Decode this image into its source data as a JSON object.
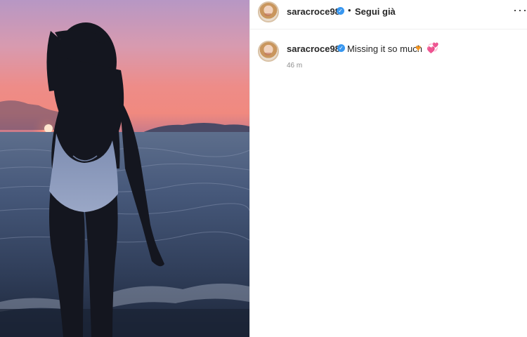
{
  "post": {
    "username": "saracroce98",
    "verified_icon": "verified-badge-icon",
    "separator": "•",
    "follow_label": "Segui già",
    "more_icon": "more-options-icon",
    "more_glyph": "···"
  },
  "caption": {
    "username": "saracroce98",
    "text": "Missing it so much",
    "emoji_1": "♥",
    "emoji_1_icon": "orange-heart-icon",
    "emoji_2": "💞",
    "emoji_2_icon": "revolving-hearts-icon",
    "time": "46 m"
  },
  "colors": {
    "verified": "#3897f0",
    "text": "#262626",
    "muted": "#8e8e8e",
    "sunset": "#f0897f"
  }
}
